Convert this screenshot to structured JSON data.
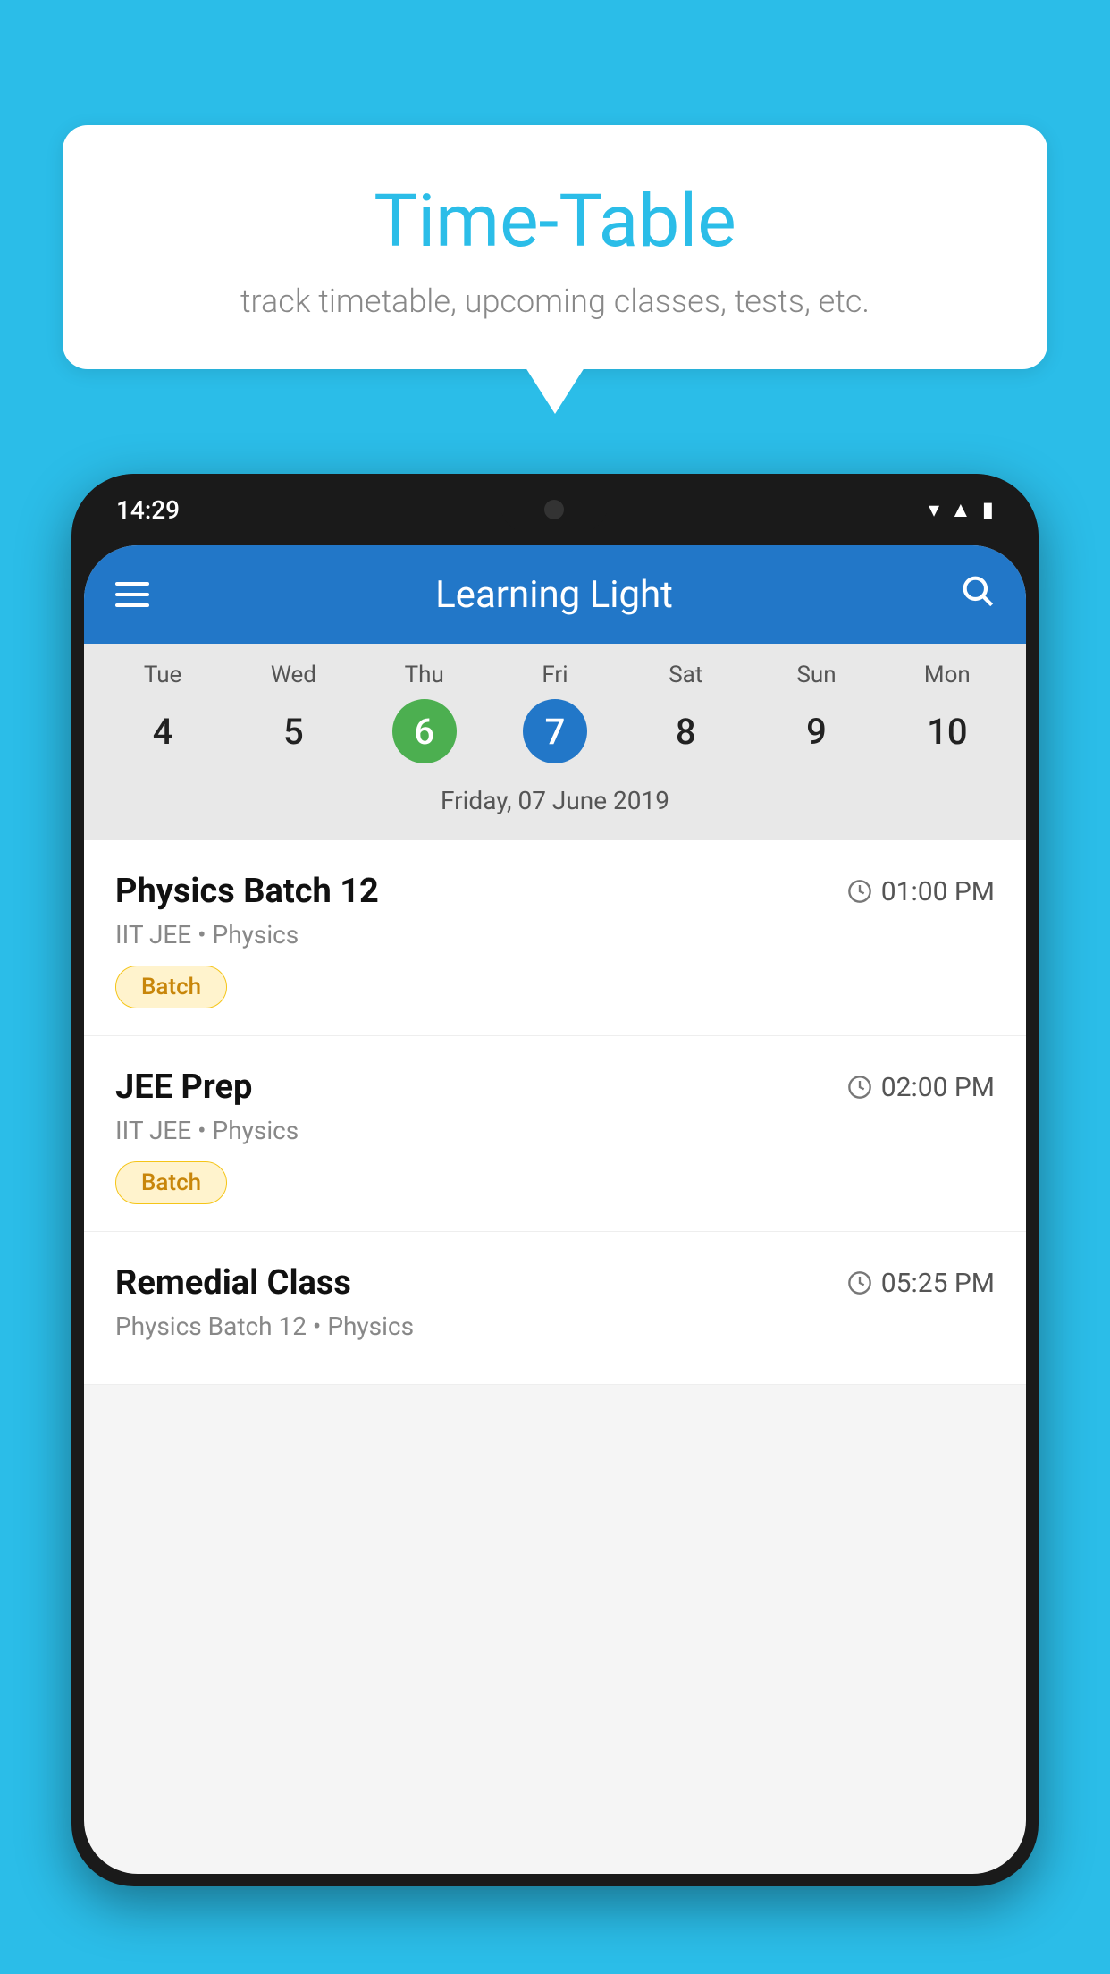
{
  "background_color": "#2BBDE8",
  "bubble": {
    "title": "Time-Table",
    "subtitle": "track timetable, upcoming classes, tests, etc."
  },
  "phone": {
    "status_time": "14:29",
    "app_title": "Learning Light",
    "selected_date_label": "Friday, 07 June 2019",
    "week_days": [
      {
        "name": "Tue",
        "num": "4",
        "state": "normal"
      },
      {
        "name": "Wed",
        "num": "5",
        "state": "normal"
      },
      {
        "name": "Thu",
        "num": "6",
        "state": "today"
      },
      {
        "name": "Fri",
        "num": "7",
        "state": "selected"
      },
      {
        "name": "Sat",
        "num": "8",
        "state": "normal"
      },
      {
        "name": "Sun",
        "num": "9",
        "state": "normal"
      },
      {
        "name": "Mon",
        "num": "10",
        "state": "normal"
      }
    ],
    "schedule_items": [
      {
        "title": "Physics Batch 12",
        "time": "01:00 PM",
        "subtitle": "IIT JEE • Physics",
        "badge": "Batch"
      },
      {
        "title": "JEE Prep",
        "time": "02:00 PM",
        "subtitle": "IIT JEE • Physics",
        "badge": "Batch"
      },
      {
        "title": "Remedial Class",
        "time": "05:25 PM",
        "subtitle": "Physics Batch 12 • Physics",
        "badge": null
      }
    ]
  }
}
